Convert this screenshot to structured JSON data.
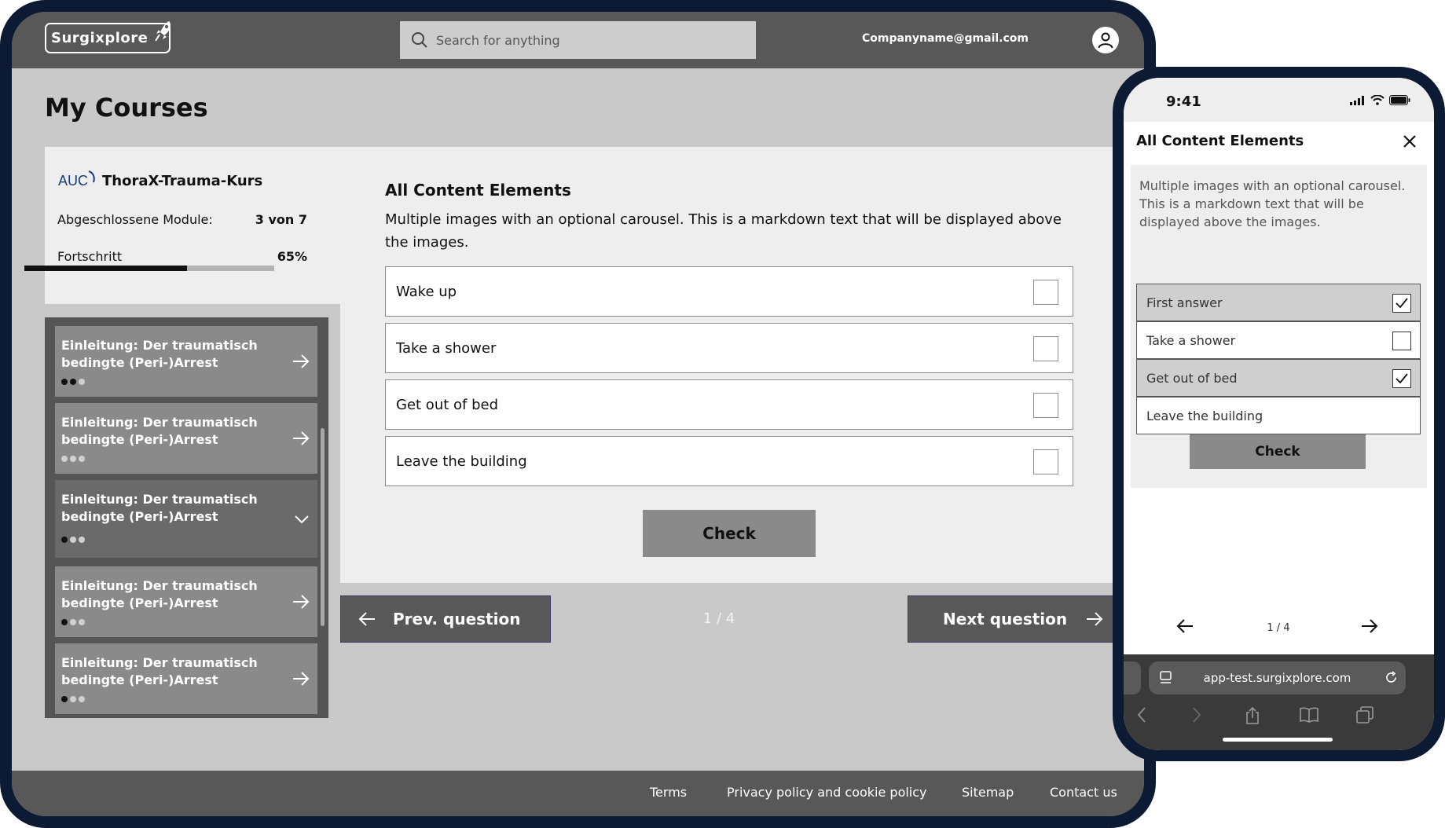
{
  "header": {
    "logo_text": "Surgixplore",
    "search_placeholder": "Search for anything",
    "user_email": "Companyname@gmail.com"
  },
  "page_title": "My Courses",
  "course": {
    "logo_text": "AUC",
    "name": "ThoraX-Trauma-Kurs",
    "completed_label": "Abgeschlossene Module:",
    "completed_value": "3 von 7",
    "progress_label": "Fortschritt",
    "progress_value": "65%",
    "progress_fraction": 0.65
  },
  "modules": [
    {
      "title": "Einleitung: Der traumatisch bedingte (Peri-)Arrest",
      "dots_filled": 2,
      "icon": "arrow-right-icon"
    },
    {
      "title": "Einleitung: Der traumatisch bedingte (Peri-)Arrest",
      "dots_filled": 0,
      "icon": "arrow-right-icon"
    },
    {
      "title": "Einleitung: Der traumatisch bedingte (Peri-)Arrest",
      "dots_filled": 1,
      "icon": "chevron-down-icon"
    },
    {
      "title": "Einleitung: Der traumatisch bedingte (Peri-)Arrest",
      "dots_filled": 1,
      "icon": "arrow-right-icon"
    },
    {
      "title": "Einleitung: Der traumatisch bedingte (Peri-)Arrest",
      "dots_filled": 1,
      "icon": "arrow-right-icon"
    }
  ],
  "content": {
    "title": "All Content Elements",
    "description": "Multiple images with an optional carousel. This is a markdown text that will be displayed above the images.",
    "answers": [
      "Wake up",
      "Take a shower",
      "Get out of bed",
      "Leave the building"
    ],
    "check_label": "Check"
  },
  "pagination": {
    "prev_label": "Prev. question",
    "next_label": "Next question",
    "indicator": "1 / 4"
  },
  "footer": {
    "links": [
      "Terms",
      "Privacy policy and cookie policy",
      "Sitemap",
      "Contact us"
    ]
  },
  "mobile": {
    "time": "9:41",
    "title": "All Content Elements",
    "description": "Multiple images with an optional carousel. This is a markdown text that will be displayed above the images.",
    "answers": [
      {
        "label": "First answer",
        "checked": true
      },
      {
        "label": "Take a shower",
        "checked": false
      },
      {
        "label": "Get out of bed",
        "checked": true
      },
      {
        "label": "Leave the building",
        "checked": false
      }
    ],
    "check_label": "Check",
    "indicator": "1 / 4",
    "url": "app-test.surgixplore.com"
  },
  "colors": {
    "header_bg": "#585858",
    "frame": "#0c1a33",
    "page_bg": "#c9c9c9",
    "panel_bg": "#eeeeee",
    "button_gray": "#8a8a8a"
  }
}
